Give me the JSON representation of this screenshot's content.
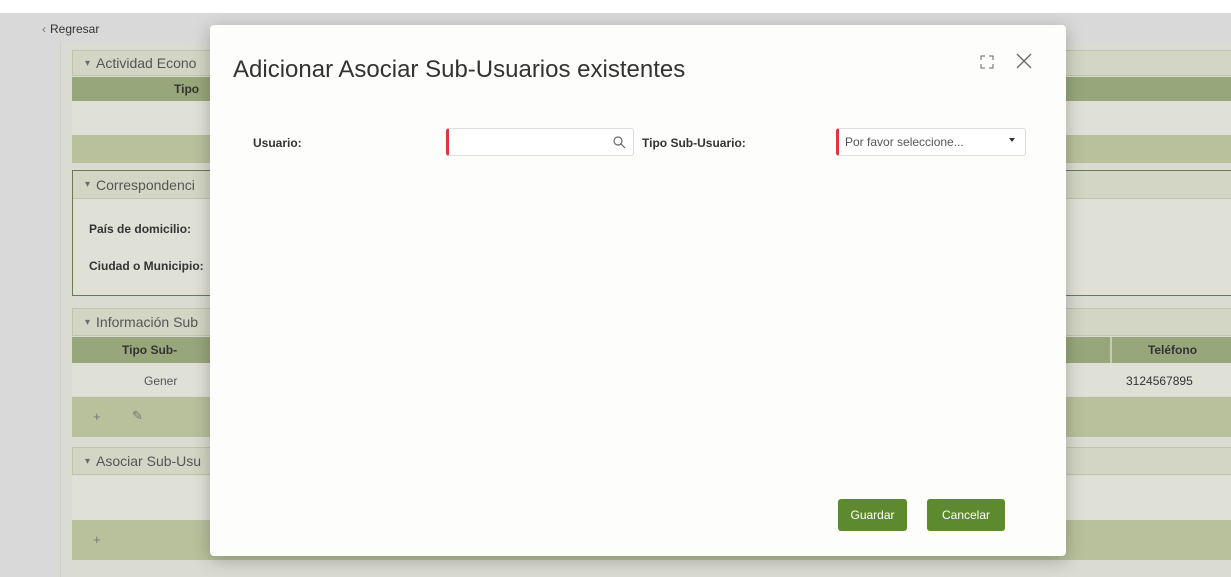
{
  "nav": {
    "back_label": "Regresar"
  },
  "background": {
    "sections": {
      "actividad": "Actividad Econo",
      "correspondencia": "Correspondenci",
      "informacion": "Información Sub",
      "asociar": "Asociar Sub-Usu"
    },
    "actividad_col": "Tipo",
    "corr_pais_label": "País de domicilio:",
    "corr_ciudad_label": "Ciudad o Municipio:",
    "info_col_tipo": "Tipo Sub-",
    "info_col_tel": "Teléfono",
    "info_row_tipo": "Gener",
    "info_row_tel": "3124567895"
  },
  "modal": {
    "title": "Adicionar Asociar Sub-Usuarios existentes",
    "usuario_label": "Usuario:",
    "usuario_value": "",
    "tipo_label": "Tipo Sub-Usuario:",
    "tipo_placeholder": "Por favor seleccione...",
    "save_label": "Guardar",
    "cancel_label": "Cancelar",
    "colors": {
      "required": "#e0353d",
      "button": "#5d8a2e"
    }
  }
}
